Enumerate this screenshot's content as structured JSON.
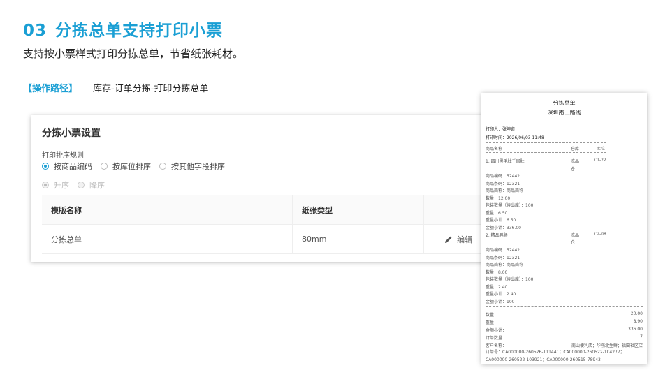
{
  "header": {
    "number": "03",
    "title": "分拣总单支持打印小票",
    "subtitle": "支持按小票样式打印分拣总单，节省纸张耗材。",
    "path_label": "【操作路径】",
    "path_value": "库存-订单分拣-打印分拣总单"
  },
  "panel": {
    "title": "分拣小票设置",
    "rule_label": "打印排序规则",
    "sort_options": [
      {
        "label": "按商品编码",
        "selected": true
      },
      {
        "label": "按库位排序",
        "selected": false
      },
      {
        "label": "按其他字段排序",
        "selected": false
      }
    ],
    "order_options": [
      {
        "label": "升序",
        "selected": true,
        "disabled": true
      },
      {
        "label": "降序",
        "selected": false,
        "disabled": true
      }
    ],
    "table": {
      "columns": [
        "模版名称",
        "纸张类型",
        ""
      ],
      "rows": [
        {
          "name": "分拣总单",
          "paper": "80mm",
          "action": "编辑"
        }
      ]
    }
  },
  "ticket": {
    "title": "分拣总单",
    "store": "深圳南山路线",
    "printer": "打印人：张坤道",
    "print_time": "打印时间：2026/06/03 11:48",
    "col_name": "商品名称",
    "col_warehouse": "仓库",
    "col_location": "库位",
    "items": [
      {
        "name": "1. 四川黑毛肚千层肚",
        "warehouse_1": "冻品",
        "warehouse_2": "仓",
        "location": "C1-22",
        "lines": [
          "商品编码：52442",
          "商品条码：12321",
          "商品简称：商品简称",
          "数量：12.00",
          "包装数量（待出库）：100",
          "重量：6.50",
          "重量小计：6.50",
          "金额小计：336.00"
        ]
      },
      {
        "name": "2. 精品鸭肠",
        "warehouse_1": "冻品",
        "warehouse_2": "仓",
        "location": "C2-08",
        "lines": [
          "商品编码：52442",
          "商品条码：12321",
          "商品简称：商品简称",
          "数量：8.00",
          "包装数量（待出库）：100",
          "重量：2.40",
          "重量小计：2.40",
          "金额小计：100"
        ]
      }
    ],
    "summary": [
      {
        "label": "数量：",
        "value": "20.00"
      },
      {
        "label": "重量：",
        "value": "8.90"
      },
      {
        "label": "金额小计：",
        "value": "336.00"
      },
      {
        "label": "订单数量：",
        "value": "7"
      },
      {
        "label": "客户名称：",
        "value": "南山便利店；华强北生鲜；福田社区店"
      }
    ],
    "orders_label": "订单号：",
    "orders_value": "CA000000-260526-111441；CA000000-260522-104277；CA000000-260522-103921；CA000000-260515-78943"
  }
}
